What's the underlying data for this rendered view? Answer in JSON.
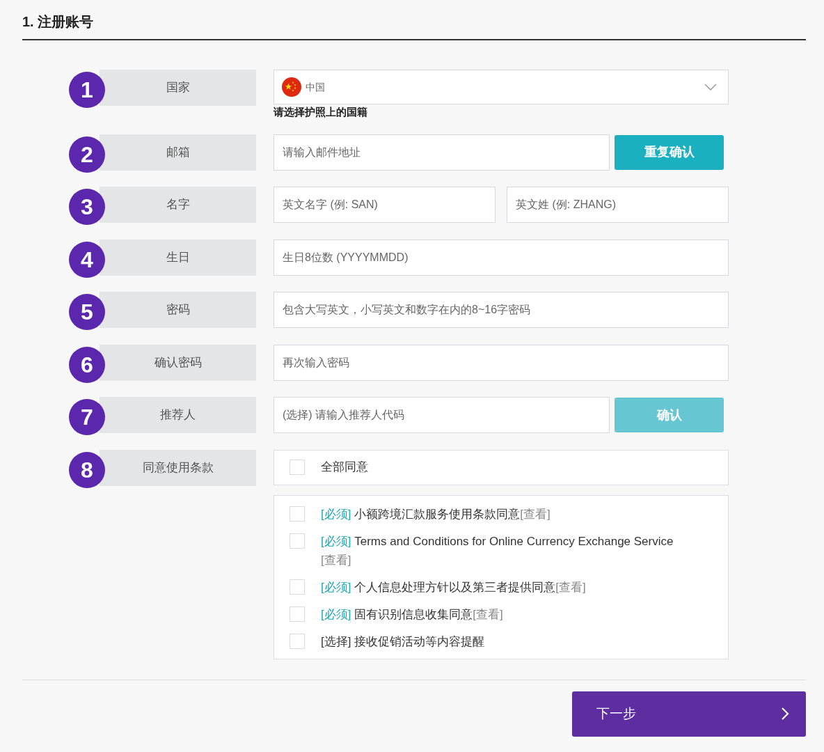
{
  "title": "1. 注册账号",
  "fields": [
    {
      "number": "1",
      "label": "国家",
      "kind": "select",
      "value": "中国",
      "hint": "请选择护照上的国籍"
    },
    {
      "number": "2",
      "label": "邮箱",
      "kind": "input_button",
      "placeholder": "请输入邮件地址",
      "button": {
        "label": "重复确认",
        "disabled": false
      }
    },
    {
      "number": "3",
      "label": "名字",
      "kind": "input_pair",
      "inputs": [
        {
          "placeholder": "英文名字 (例: SAN)"
        },
        {
          "placeholder": "英文姓 (例: ZHANG)"
        }
      ]
    },
    {
      "number": "4",
      "label": "生日",
      "kind": "input",
      "placeholder": "生日8位数 (YYYYMMDD)"
    },
    {
      "number": "5",
      "label": "密码",
      "kind": "input",
      "placeholder": "包含大写英文，小写英文和数字在内的8~16字密码"
    },
    {
      "number": "6",
      "label": "确认密码",
      "kind": "input",
      "placeholder": "再次输入密码"
    },
    {
      "number": "7",
      "label": "推荐人",
      "kind": "input_button",
      "placeholder": "(选择) 请输入推荐人代码",
      "button": {
        "label": "确认",
        "disabled": true
      }
    },
    {
      "number": "8",
      "label": "同意使用条款",
      "kind": "agreement",
      "all": {
        "label": "全部同意",
        "checked": false
      },
      "items": [
        {
          "tag": "[必须]",
          "required": true,
          "text": "小额跨境汇款服务使用条款同意",
          "link": "[查看]",
          "checked": false
        },
        {
          "tag": "[必须]",
          "required": true,
          "text": "Terms and Conditions for Online Currency Exchange Service",
          "link": "[查看]",
          "checked": false
        },
        {
          "tag": "[必须]",
          "required": true,
          "text": "个人信息处理方针以及第三者提供同意",
          "link": "[查看]",
          "checked": false
        },
        {
          "tag": "[必须]",
          "required": true,
          "text": "固有识别信息收集同意",
          "link": "[查看]",
          "checked": false
        },
        {
          "tag": "[选择]",
          "required": false,
          "text": "接收促销活动等内容提醒",
          "checked": false
        }
      ]
    }
  ],
  "next_button": {
    "label": "下一步"
  }
}
